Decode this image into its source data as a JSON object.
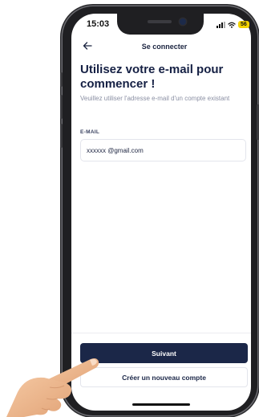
{
  "status_bar": {
    "time": "15:03",
    "battery": "56",
    "icons": [
      "signal-icon",
      "wifi-icon",
      "battery-icon"
    ]
  },
  "nav": {
    "title": "Se connecter",
    "back_icon": "arrow-left-icon"
  },
  "content": {
    "headline": "Utilisez votre e-mail pour commencer !",
    "subtitle": "Veuillez utiliser l'adresse e-mail d'un compte existant",
    "email_label": "E-MAIL",
    "email_value": "xxxxxx @gmail.com"
  },
  "actions": {
    "next_label": "Suivant",
    "create_account_label": "Créer un nouveau compte"
  },
  "colors": {
    "primary": "#1b2748",
    "headline": "#152044",
    "subtitle": "#8a8fa3",
    "battery": "#f2d200"
  }
}
